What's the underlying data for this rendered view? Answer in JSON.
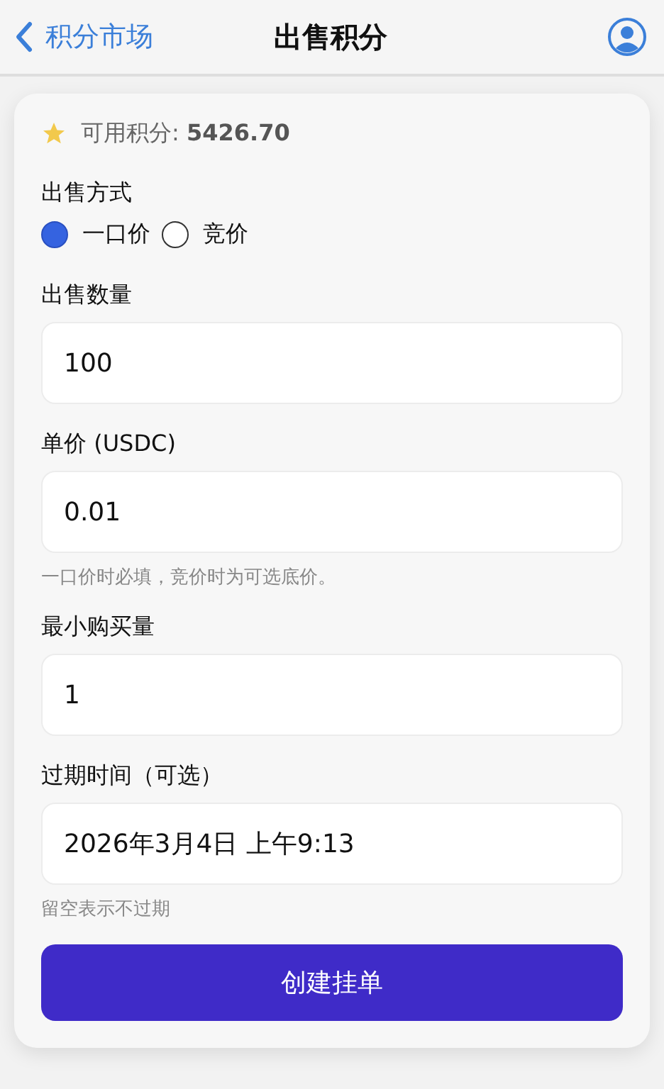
{
  "header": {
    "back_label": "积分市场",
    "title": "出售积分"
  },
  "balance": {
    "text": "可用积分: **5426.70**"
  },
  "sale_method": {
    "label": "出售方式",
    "options": [
      {
        "label": "一口价",
        "selected": true
      },
      {
        "label": "竞价",
        "selected": false
      }
    ]
  },
  "fields": [
    {
      "label": "出售数量",
      "value": "100"
    },
    {
      "label": "单价 (USDC)",
      "value": "0.01",
      "hint": "一口价时必填，竞价时为可选底价。"
    },
    {
      "label": "最小购买量",
      "value": "1"
    },
    {
      "label": "过期时间（可选）",
      "value": "2026年3月4日 上午9:13",
      "hint": "留空表示不过期"
    }
  ],
  "submit_button": "创建挂单"
}
